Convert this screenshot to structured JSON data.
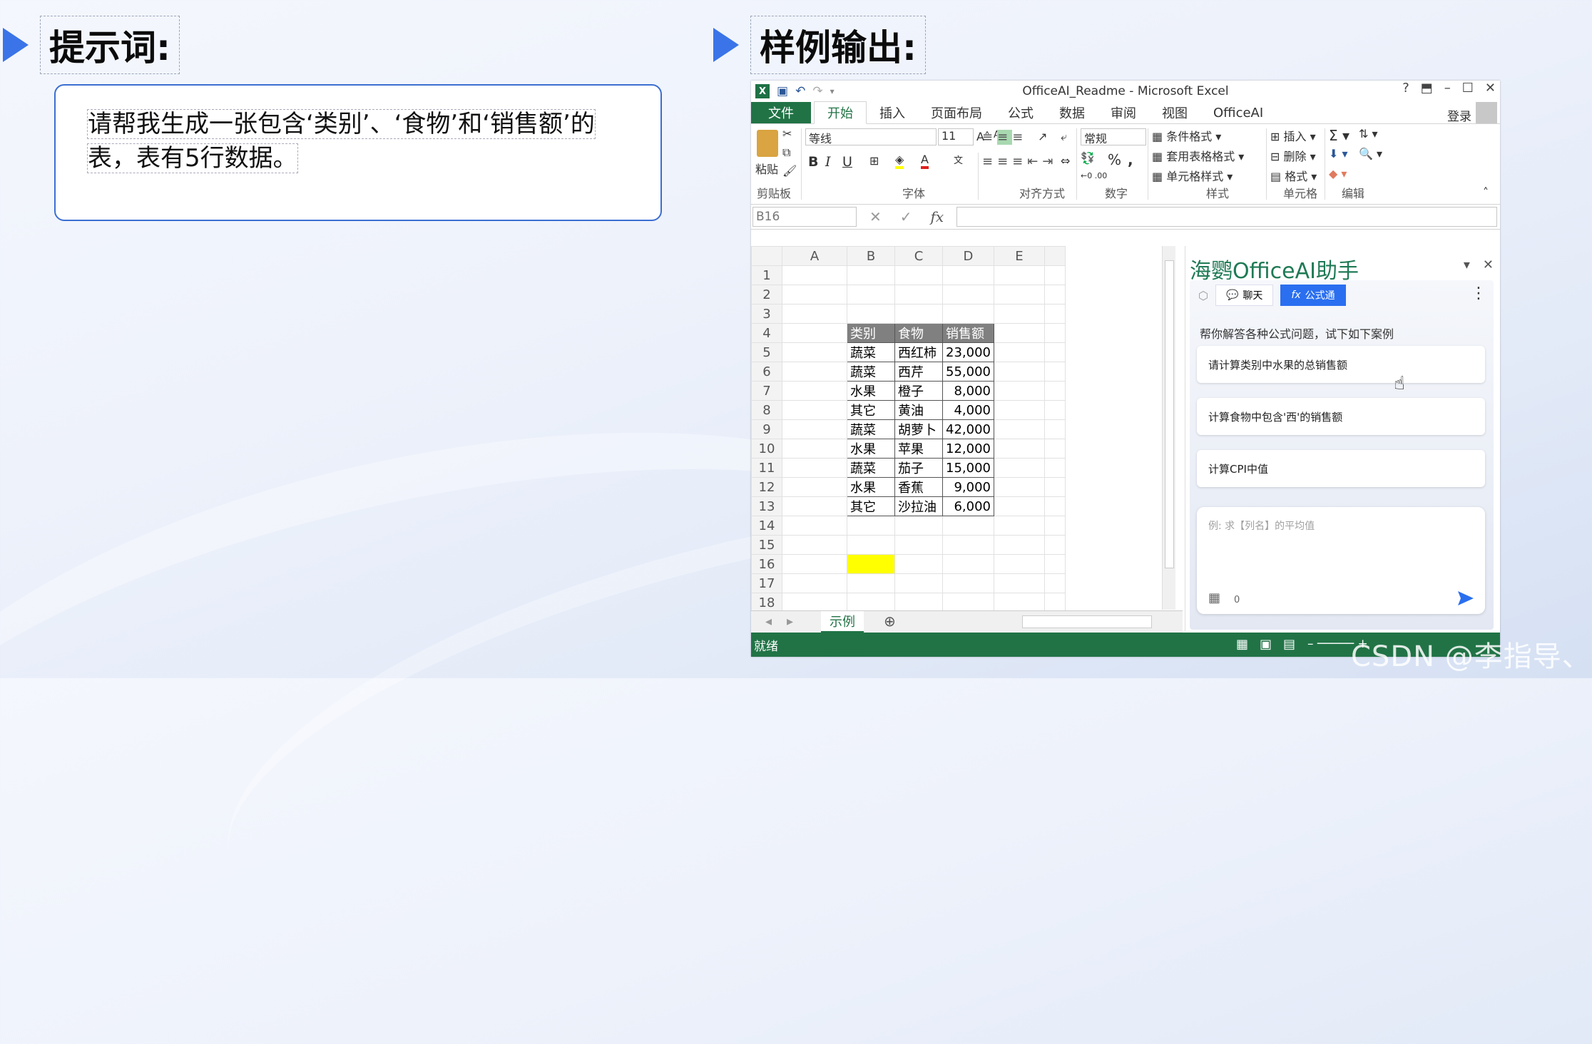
{
  "headings": {
    "prompt": "提示词:",
    "output": "样例输出:"
  },
  "prompt_text": {
    "line1": "请帮我生成一张包含‘类别’、‘食物’和‘销售额’的",
    "line2": "表，表有5行数据。"
  },
  "excel": {
    "title": "OfficeAI_Readme - Microsoft Excel",
    "tabs": [
      "文件",
      "开始",
      "插入",
      "页面布局",
      "公式",
      "数据",
      "审阅",
      "视图",
      "OfficeAI"
    ],
    "login": "登录",
    "clipboard": {
      "paste": "粘贴",
      "label": "剪贴板"
    },
    "font": {
      "name": "等线",
      "size": "11",
      "label": "字体",
      "bold": "B",
      "italic": "I",
      "underline": "U"
    },
    "alignment": {
      "label": "对齐方式"
    },
    "number": {
      "format": "常规",
      "percent": "%",
      "comma": ",",
      "label": "数字"
    },
    "styles": {
      "conditional": "条件格式",
      "table": "套用表格格式",
      "cell": "单元格样式",
      "label": "样式"
    },
    "cells": {
      "insert": "插入",
      "delete": "删除",
      "format": "格式",
      "label": "单元格"
    },
    "editing": {
      "label": "编辑"
    },
    "name_box": "B16",
    "fx": "fx",
    "columns": [
      "A",
      "B",
      "C",
      "D",
      "E"
    ],
    "rows": [
      {
        "n": "1",
        "b": "",
        "c": "",
        "d": ""
      },
      {
        "n": "2",
        "b": "",
        "c": "",
        "d": ""
      },
      {
        "n": "3",
        "b": "",
        "c": "",
        "d": ""
      },
      {
        "n": "4",
        "b": "类别",
        "c": "食物",
        "d": "销售额"
      },
      {
        "n": "5",
        "b": "蔬菜",
        "c": "西红柿",
        "d": "23,000"
      },
      {
        "n": "6",
        "b": "蔬菜",
        "c": "西芹",
        "d": "55,000"
      },
      {
        "n": "7",
        "b": "水果",
        "c": "橙子",
        "d": "8,000"
      },
      {
        "n": "8",
        "b": "其它",
        "c": "黄油",
        "d": "4,000"
      },
      {
        "n": "9",
        "b": "蔬菜",
        "c": "胡萝卜",
        "d": "42,000"
      },
      {
        "n": "10",
        "b": "水果",
        "c": "苹果",
        "d": "12,000"
      },
      {
        "n": "11",
        "b": "蔬菜",
        "c": "茄子",
        "d": "15,000"
      },
      {
        "n": "12",
        "b": "水果",
        "c": "香蕉",
        "d": "9,000"
      },
      {
        "n": "13",
        "b": "其它",
        "c": "沙拉油",
        "d": "6,000"
      },
      {
        "n": "14",
        "b": "",
        "c": "",
        "d": ""
      },
      {
        "n": "15",
        "b": "",
        "c": "",
        "d": ""
      },
      {
        "n": "16",
        "b": "",
        "c": "",
        "d": ""
      },
      {
        "n": "17",
        "b": "",
        "c": "",
        "d": ""
      },
      {
        "n": "18",
        "b": "",
        "c": "",
        "d": ""
      }
    ],
    "sheet_tab": "示例",
    "status": "就绪"
  },
  "ai": {
    "title": "海鹦OfficeAI助手",
    "tab_chat": "聊天",
    "tab_formula": "公式通",
    "hint": "帮你解答各种公式问题，试下如下案例",
    "cards": [
      "请计算类别中水果的总销售额",
      "计算食物中包含'西'的销售额",
      "计算CPI中值"
    ],
    "input_placeholder": "例: 求【列名】的平均值",
    "char_count": "0"
  },
  "watermark": "CSDN @李指导、",
  "colors": {
    "excel_green": "#217346",
    "accent_blue": "#3a74e8",
    "ai_green": "#1f7a55",
    "highlight_yellow": "#ffff00"
  }
}
